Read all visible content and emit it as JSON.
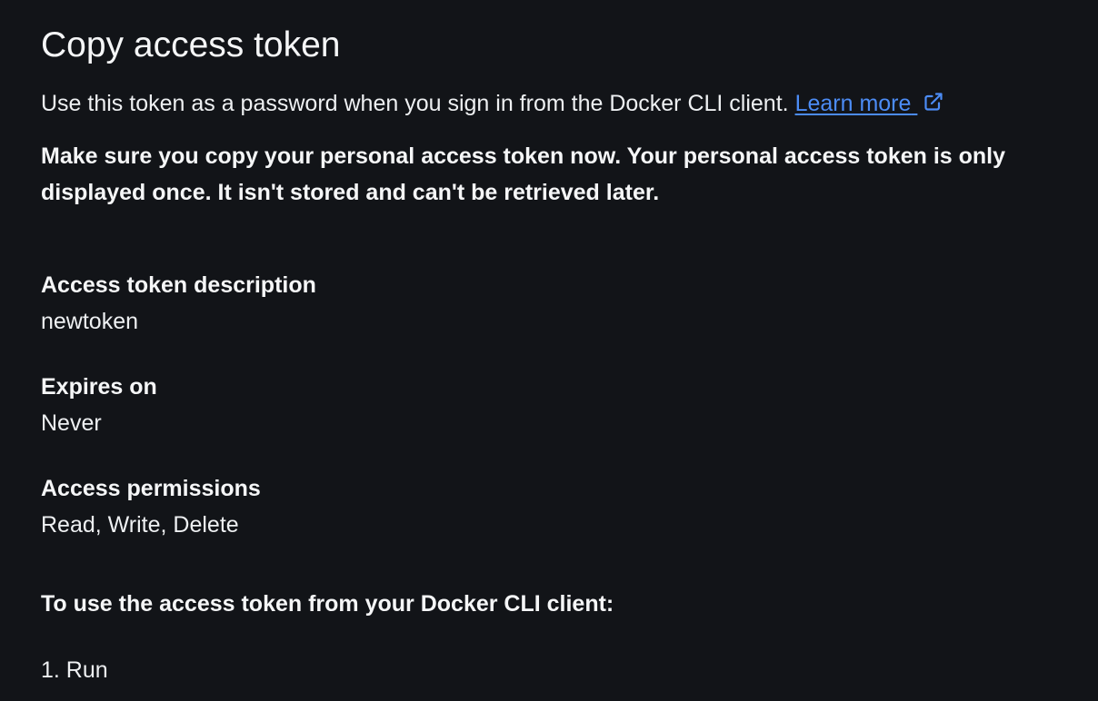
{
  "title": "Copy access token",
  "intro": {
    "text": "Use this token as a password when you sign in from the Docker CLI client.",
    "link_label": "Learn more",
    "link_icon": "external-link-icon",
    "link_color": "#4c8cf5"
  },
  "warning": "Make sure you copy your personal access token now. Your personal access token is only displayed once. It isn't stored and can't be retrieved later.",
  "fields": {
    "description": {
      "label": "Access token description",
      "value": "newtoken"
    },
    "expires": {
      "label": "Expires on",
      "value": "Never"
    },
    "permissions": {
      "label": "Access permissions",
      "value": "Read, Write, Delete"
    }
  },
  "instructions": "To use the access token from your Docker CLI client:",
  "steps": [
    "1. Run"
  ]
}
